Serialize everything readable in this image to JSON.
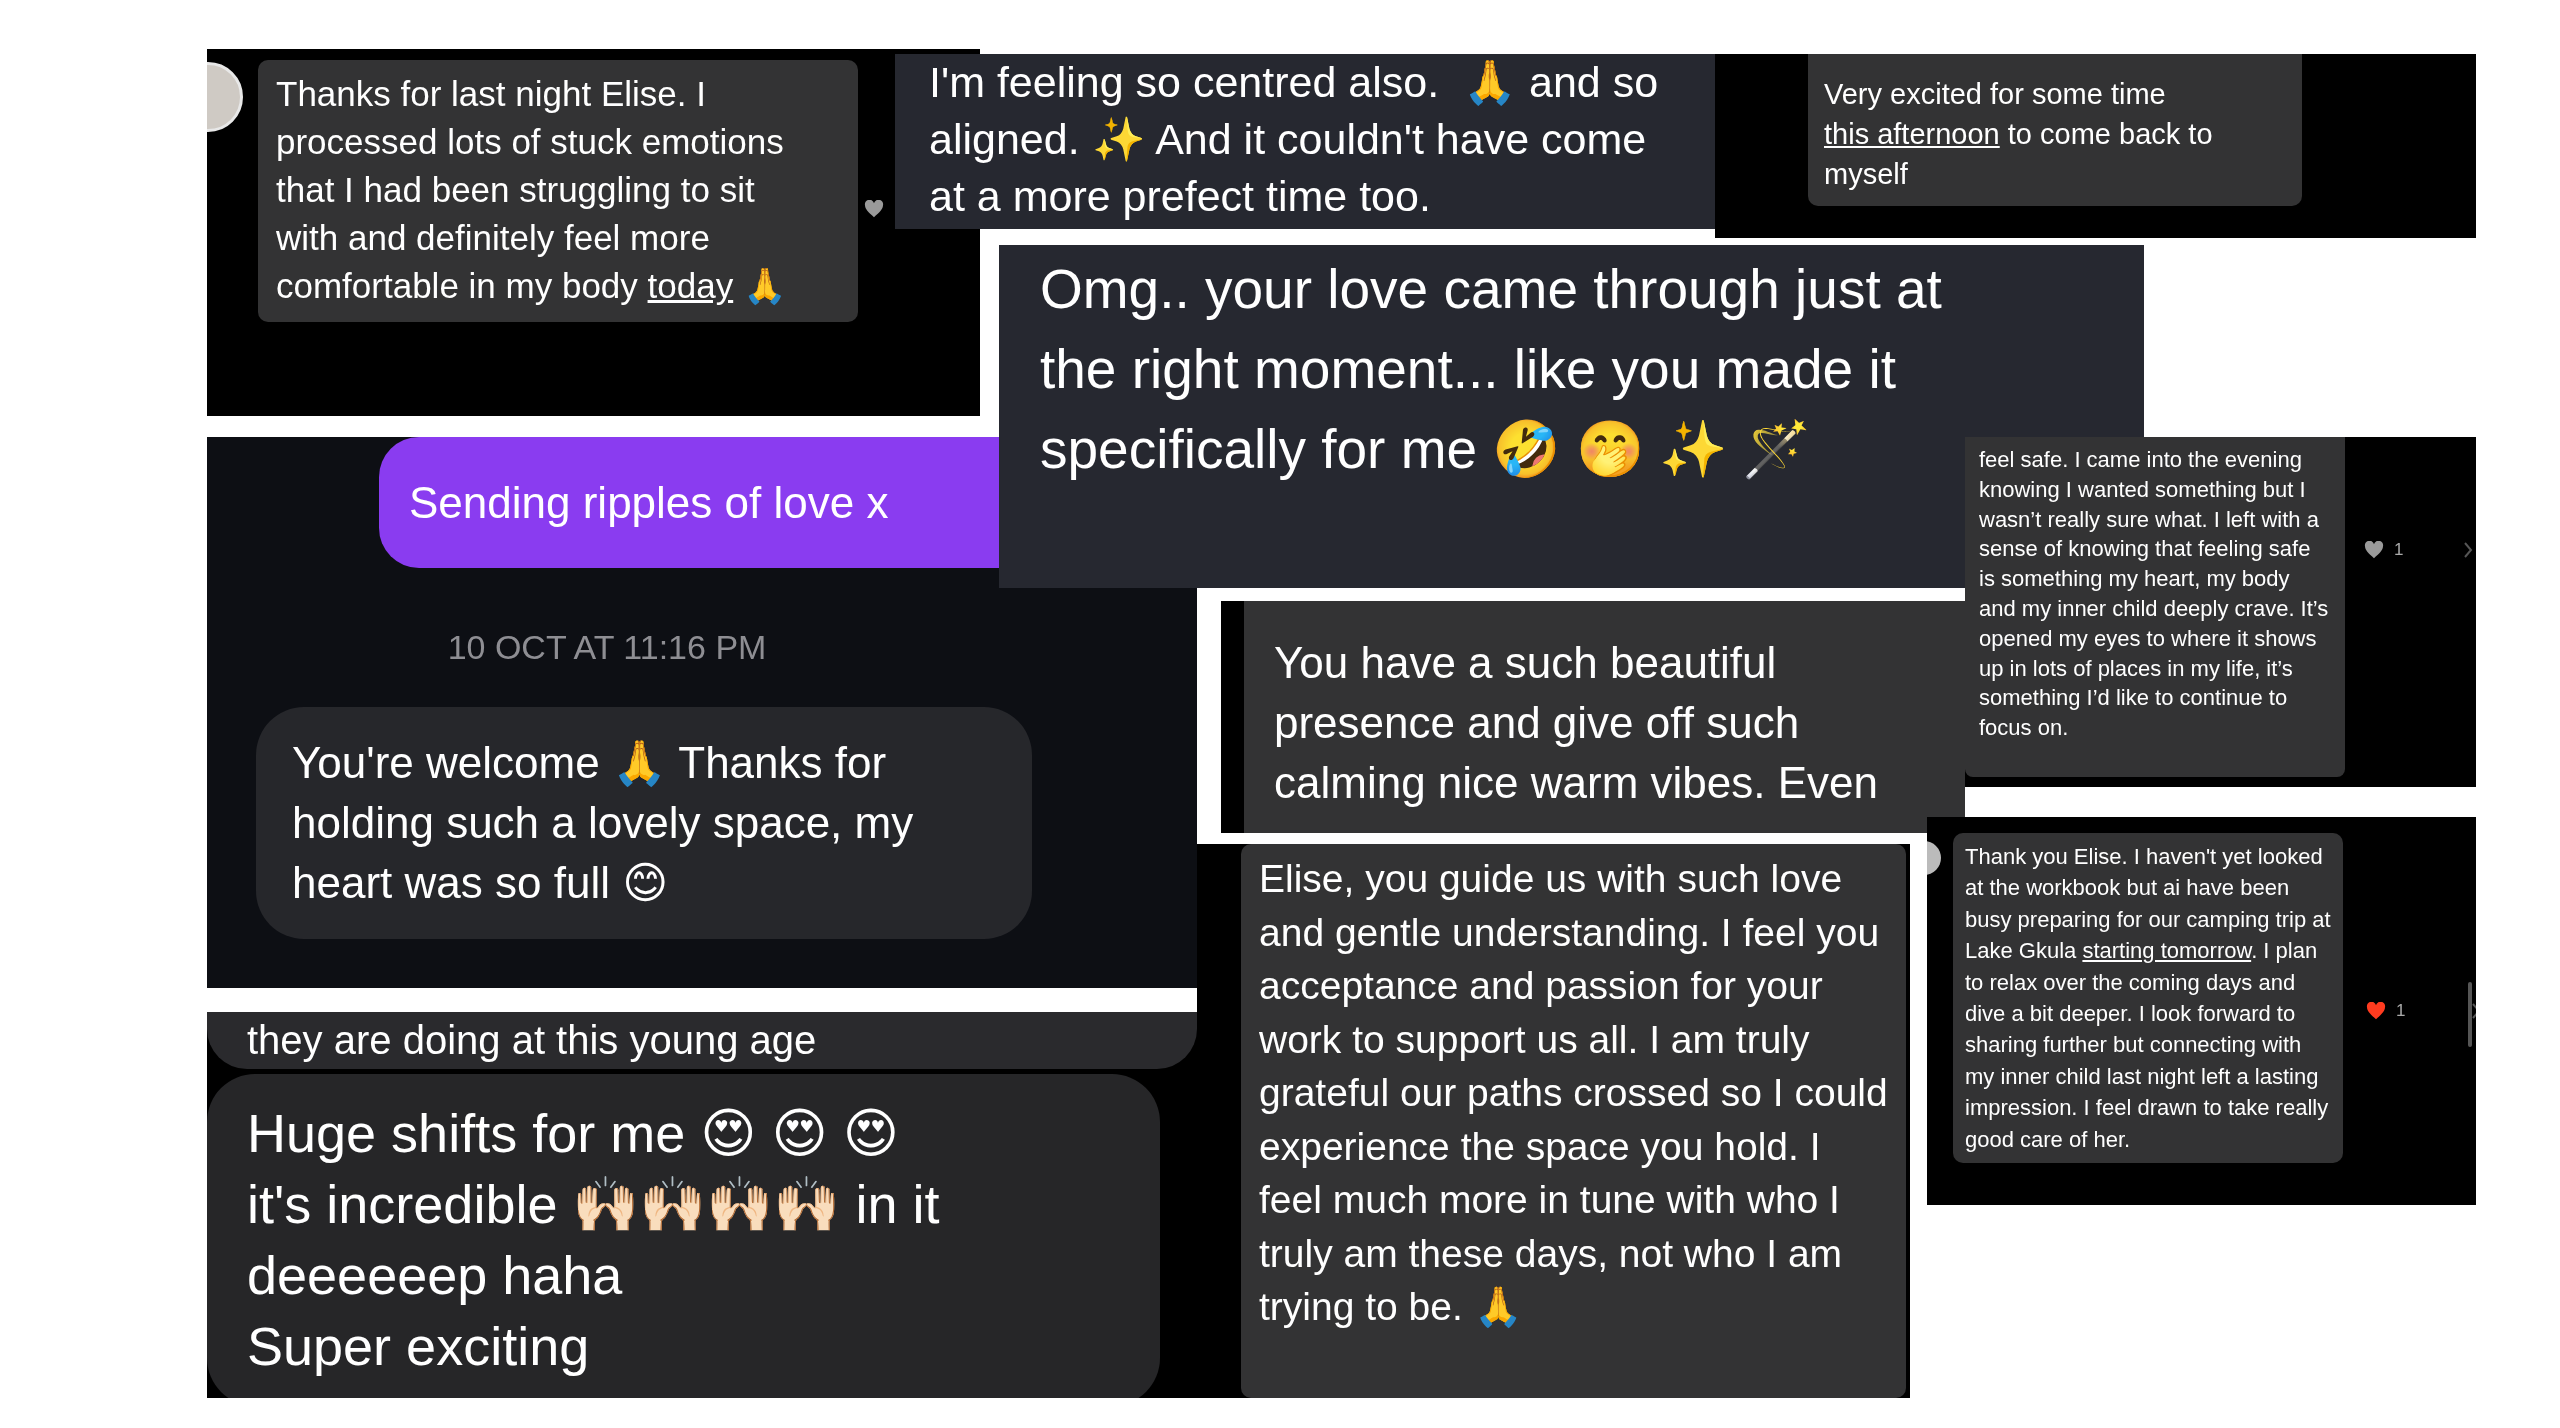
{
  "snippets": [
    {
      "messages": [
        {
          "kind": "incoming",
          "avatar": true,
          "parts": [
            {
              "kind": "plain",
              "text": "Thanks for last night Elise. I processed lots of stuck emotions that I had been struggling to sit with and definitely feel more comfortable in my body "
            },
            {
              "kind": "link",
              "text": "today"
            },
            {
              "kind": "plain",
              "text": " 🙏"
            }
          ],
          "likes": {
            "liked": false
          }
        }
      ]
    },
    {
      "messages": [
        {
          "kind": "plain",
          "parts": [
            {
              "kind": "plain",
              "text": "I'm feeling so centred also.  🙏 and so aligned. ✨ And it couldn't have come at a more prefect time too."
            }
          ]
        }
      ]
    },
    {
      "messages": [
        {
          "kind": "incoming",
          "parts": [
            {
              "kind": "plain",
              "text": "Very excited for some time "
            },
            {
              "kind": "link",
              "text": "this afternoon"
            },
            {
              "kind": "plain",
              "text": " to come back to myself"
            }
          ]
        }
      ]
    },
    {
      "messages": [
        {
          "kind": "outgoing",
          "parts": [
            {
              "kind": "plain",
              "text": "Sending ripples of love x"
            }
          ]
        },
        {
          "kind": "timestamp",
          "parts": [
            {
              "kind": "plain",
              "text": "10 OCT AT 11:16 PM"
            }
          ]
        },
        {
          "kind": "incoming",
          "parts": [
            {
              "kind": "plain",
              "text": "You're welcome 🙏 Thanks for holding such a lovely space, my heart was so full 😊"
            }
          ]
        }
      ]
    },
    {
      "messages": [
        {
          "kind": "cut",
          "parts": [
            {
              "kind": "plain",
              "text": "they are doing at this young age"
            }
          ]
        },
        {
          "kind": "incoming",
          "parts": [
            {
              "kind": "plain",
              "text": "Huge shifts for me 😍 😍 😍 it's incredible 🙌🏻🙌🏻🙌🏻🙌🏻 in it deeeeeep haha\nSuper exciting"
            }
          ]
        }
      ]
    },
    {
      "messages": [
        {
          "kind": "incoming",
          "parts": [
            {
              "kind": "plain",
              "text": "You have a such beautiful presence and give off such calming nice warm vibes. Even"
            }
          ]
        }
      ]
    },
    {
      "messages": [
        {
          "kind": "incoming",
          "parts": [
            {
              "kind": "plain",
              "text": "Elise, you guide us with such love and gentle understanding. I feel you acceptance and passion for your work to support us all. I am truly grateful our paths crossed so I could experience the space you hold. I feel much more in tune with who I truly am these days, not who I am trying to be. 🙏"
            }
          ]
        }
      ]
    },
    {
      "messages": [
        {
          "kind": "incoming",
          "parts": [
            {
              "kind": "plain",
              "text": "feel safe. I came into the evening knowing I wanted something but I wasn’t really sure what. I left with a sense of knowing that feeling safe is something my heart, my body and my inner child deeply crave. It’s opened my eyes to where it shows up in lots of places in my life, it’s something I’d like to continue to focus on."
            }
          ],
          "likes": {
            "liked": false,
            "count": "1"
          }
        }
      ]
    },
    {
      "messages": [
        {
          "kind": "incoming",
          "avatar": true,
          "parts": [
            {
              "kind": "plain",
              "text": "Thank you Elise. I haven't yet looked at the workbook but ai have been busy preparing for our camping trip at Lake Gkula "
            },
            {
              "kind": "link",
              "text": "starting tomorrow"
            },
            {
              "kind": "plain",
              "text": ". I plan to relax over the coming days and dive a bit deeper. I look forward to sharing further but connecting with my inner child last night left a lasting impression. I feel drawn to take really good care of her."
            }
          ],
          "likes": {
            "liked": true,
            "count": "1"
          }
        }
      ]
    },
    {
      "messages": [
        {
          "kind": "plain",
          "parts": [
            {
              "kind": "plain",
              "text": "Omg.. your love came through just at the right moment... like you made it specifically for me 🤣 🤭 ✨ 🪄"
            }
          ]
        }
      ]
    }
  ]
}
